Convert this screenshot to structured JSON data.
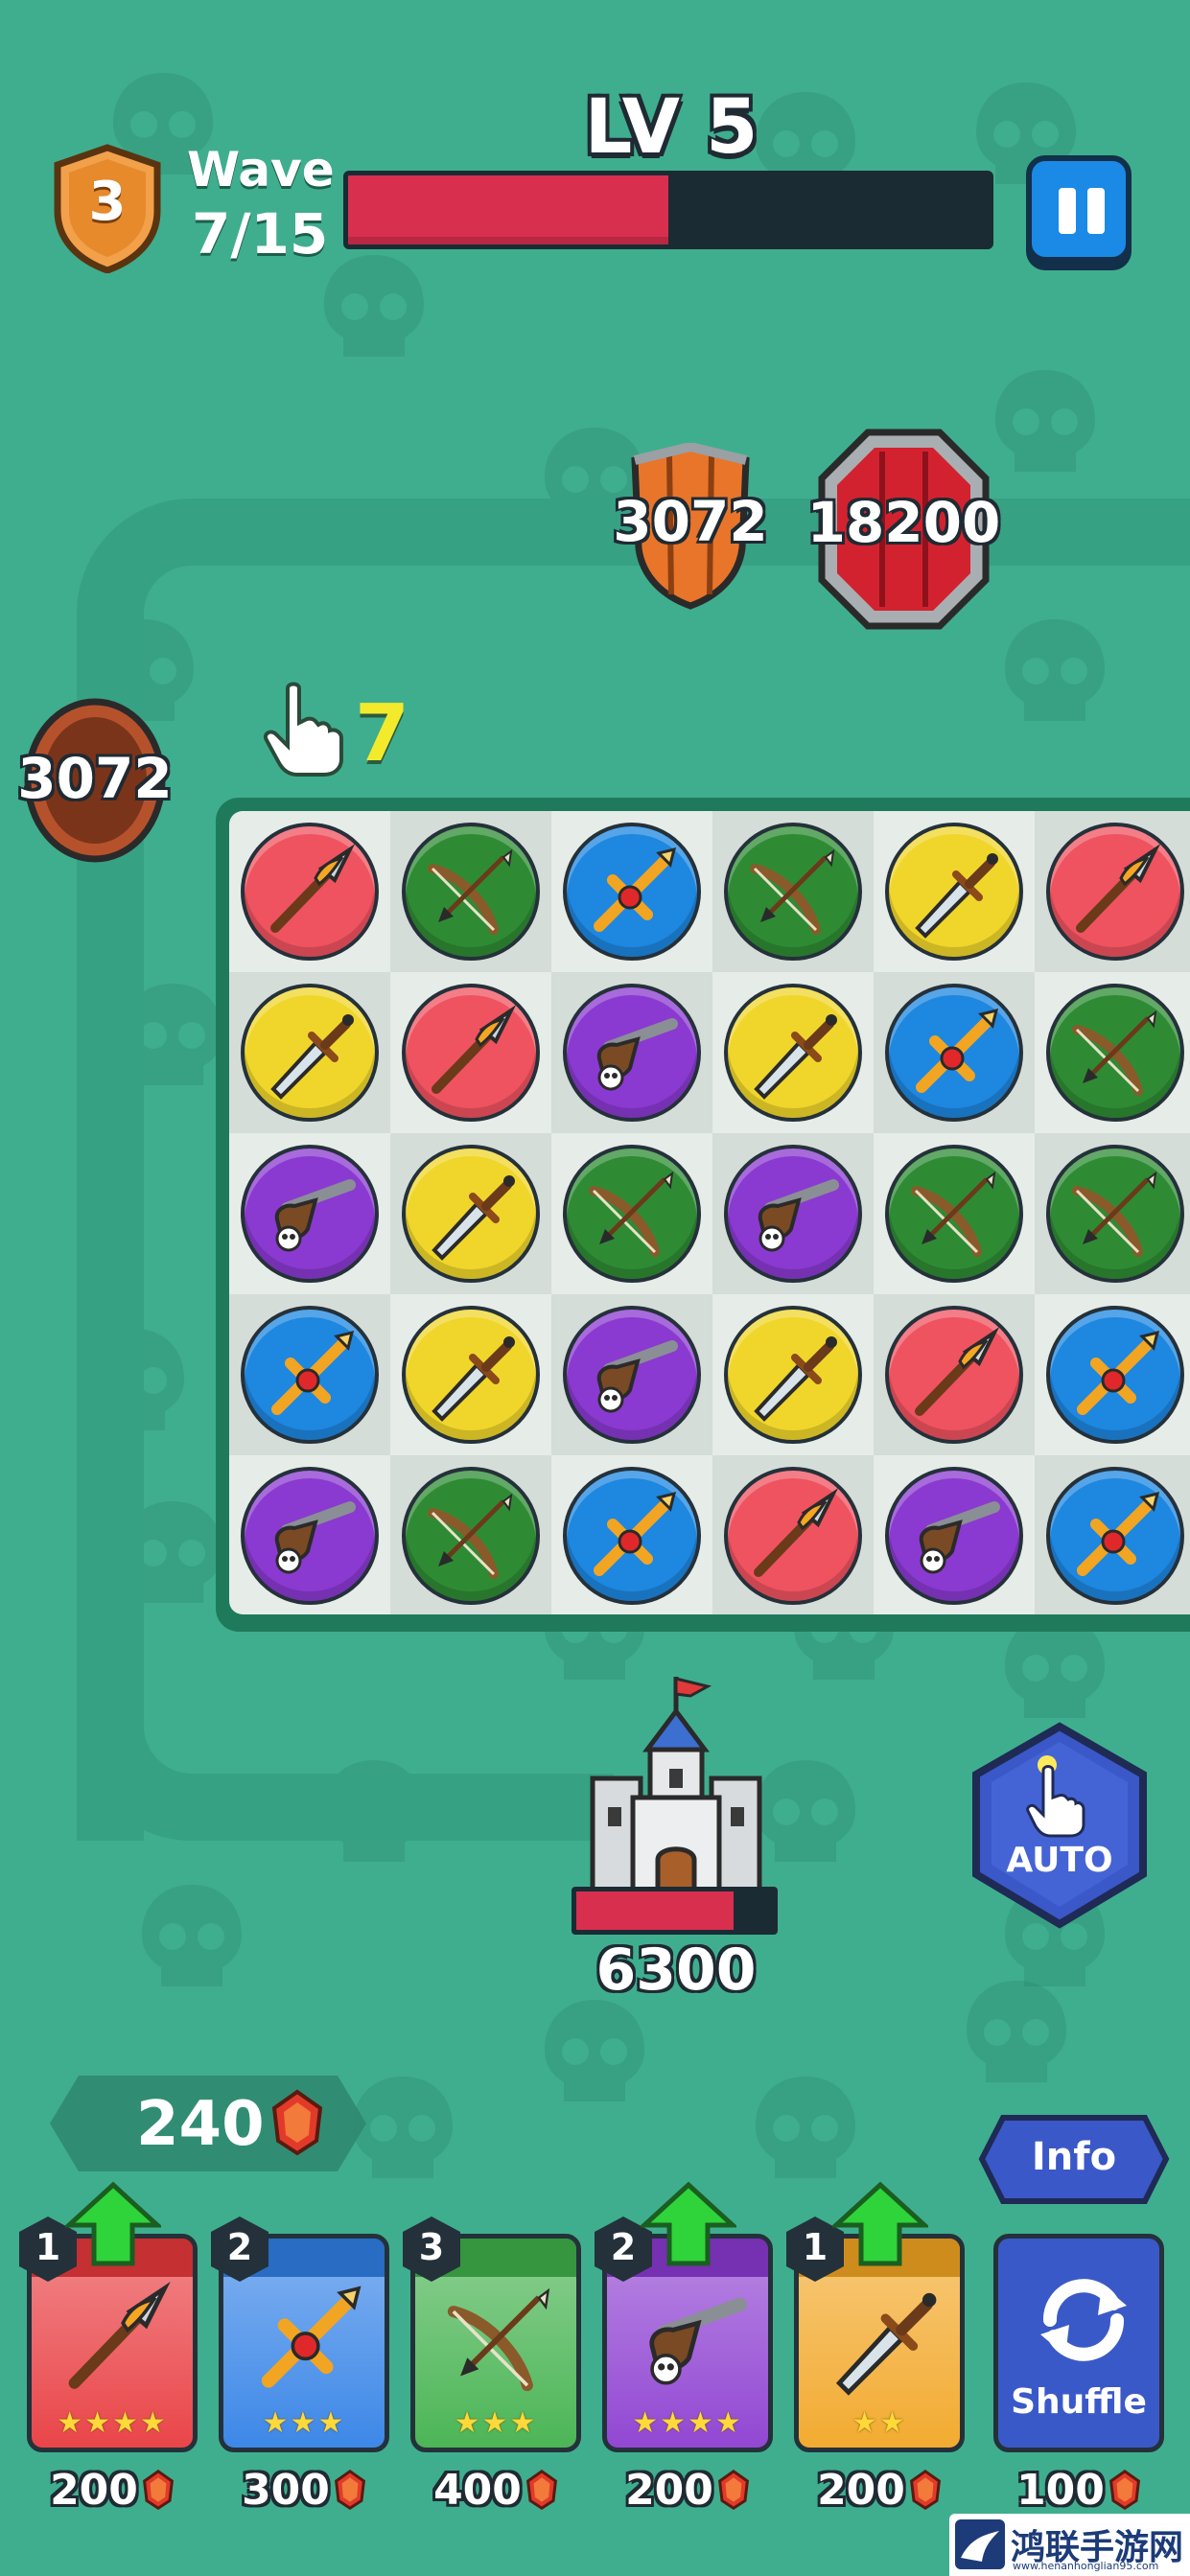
{
  "header": {
    "player_level_badge": "3",
    "wave_label": "Wave",
    "wave_count": "7/15",
    "level_title": "LV 5",
    "wave_progress": 0.5
  },
  "enemies": [
    {
      "type": "wooden-shield",
      "hp": "3072"
    },
    {
      "type": "red-octagon-shield",
      "hp": "18200"
    },
    {
      "type": "round-shield",
      "hp": "3072"
    }
  ],
  "moves": {
    "remaining": "7"
  },
  "board": {
    "rows": [
      [
        "red-spear",
        "green-bow",
        "blue-cross",
        "green-bow",
        "yellow-dagger",
        "red-spear"
      ],
      [
        "yellow-dagger",
        "red-spear",
        "purple-pistol",
        "yellow-dagger",
        "blue-cross",
        "green-bow"
      ],
      [
        "purple-pistol",
        "yellow-dagger",
        "green-bow",
        "purple-pistol",
        "green-bow",
        "green-bow"
      ],
      [
        "blue-cross",
        "yellow-dagger",
        "purple-pistol",
        "yellow-dagger",
        "red-spear",
        "blue-cross"
      ],
      [
        "purple-pistol",
        "green-bow",
        "blue-cross",
        "red-spear",
        "purple-pistol",
        "blue-cross"
      ]
    ]
  },
  "castle": {
    "hp": "6300",
    "hp_fraction": 0.8
  },
  "auto_button": {
    "label": "AUTO"
  },
  "currency": {
    "value": "240",
    "icon": "ruby-icon"
  },
  "info_button": {
    "label": "Info"
  },
  "cards": [
    {
      "weapon": "spear",
      "level": "1",
      "stars": "★★★★",
      "cost": "200",
      "upgradable": true,
      "color": "#e8383c"
    },
    {
      "weapon": "cross-staff",
      "level": "2",
      "stars": "★★★",
      "cost": "300",
      "upgradable": false,
      "color": "#2f7fe6"
    },
    {
      "weapon": "bow",
      "level": "3",
      "stars": "★★★",
      "cost": "400",
      "upgradable": false,
      "color": "#3fb04a"
    },
    {
      "weapon": "pistol",
      "level": "2",
      "stars": "★★★★",
      "cost": "200",
      "upgradable": true,
      "color": "#8a3ad0"
    },
    {
      "weapon": "dagger",
      "level": "1",
      "stars": "★★",
      "cost": "200",
      "upgradable": true,
      "color": "#f2a522"
    }
  ],
  "shuffle": {
    "label": "Shuffle",
    "cost": "100"
  },
  "watermark": {
    "main": "鸿联手游网",
    "sub": "www.henanhonglian95.com"
  },
  "colors": {
    "background": "#3fae8e",
    "health_red": "#d92f4f",
    "upgrade_green": "#2fd33a",
    "moves_yellow": "#f3ea2c"
  }
}
